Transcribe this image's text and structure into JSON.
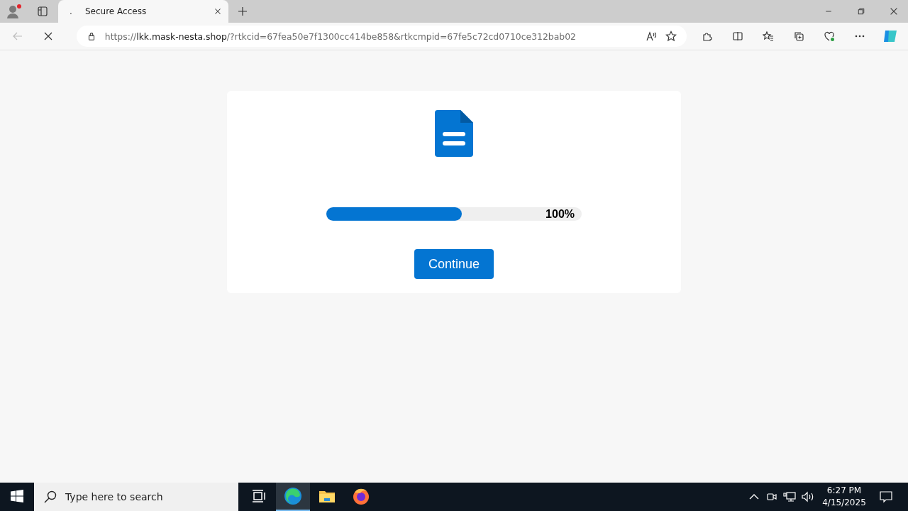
{
  "browser": {
    "tabs": [
      {
        "favicon": ".",
        "title": "Secure Access",
        "selected": true
      }
    ],
    "address": {
      "scheme": "https://",
      "host": "lkk.mask-nesta.shop",
      "rest": "/?rtkcid=67fea50e7f1300cc414be858&rtkcmpid=67fe5c72cd0710ce312bab02"
    },
    "loading": true
  },
  "card": {
    "progress": {
      "level": 0.53,
      "reading": "100%"
    },
    "button": "Continue"
  },
  "taskbar": {
    "search": {
      "placeholder": "Type here to search"
    },
    "apps": [
      {
        "kind": "taskview",
        "selected": false
      },
      {
        "kind": "edge",
        "selected": true
      },
      {
        "kind": "files",
        "selected": false
      },
      {
        "kind": "firefox",
        "selected": false
      }
    ],
    "time": "6:27 PM",
    "date": "4/15/2025"
  }
}
